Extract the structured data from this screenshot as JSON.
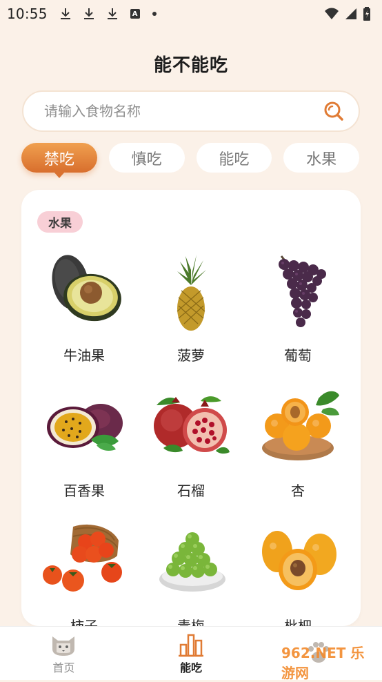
{
  "status": {
    "time": "10:55"
  },
  "app": {
    "title": "能不能吃"
  },
  "search": {
    "placeholder": "请输入食物名称"
  },
  "tabs": [
    {
      "label": "禁吃",
      "active": true
    },
    {
      "label": "慎吃",
      "active": false
    },
    {
      "label": "能吃",
      "active": false
    },
    {
      "label": "水果",
      "active": false
    }
  ],
  "category": {
    "label": "水果",
    "items": [
      {
        "name": "牛油果",
        "icon": "avocado-image"
      },
      {
        "name": "菠萝",
        "icon": "pineapple-image"
      },
      {
        "name": "葡萄",
        "icon": "grape-image"
      },
      {
        "name": "百香果",
        "icon": "passionfruit-image"
      },
      {
        "name": "石榴",
        "icon": "pomegranate-image"
      },
      {
        "name": "杏",
        "icon": "apricot-image"
      },
      {
        "name": "柿子",
        "icon": "persimmon-image"
      },
      {
        "name": "青梅",
        "icon": "greenplum-image"
      },
      {
        "name": "枇杷",
        "icon": "loquat-image"
      }
    ]
  },
  "bottom_nav": [
    {
      "label": "首页",
      "icon": "cat-home-icon",
      "active": false
    },
    {
      "label": "能吃",
      "icon": "bars-icon",
      "active": true
    },
    {
      "label": "",
      "icon": "paw-icon",
      "active": false
    }
  ],
  "watermark": {
    "text": "962.NET 乐游网"
  },
  "colors": {
    "background": "#fbf1e8",
    "accent": "#e07b34",
    "pill": "#f8cfd6"
  }
}
